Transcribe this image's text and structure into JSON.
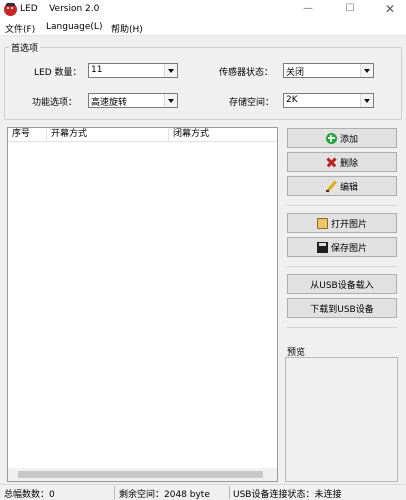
{
  "window": {
    "title": "LED    Version 2.0",
    "min_glyph": "—",
    "max_glyph": "☐",
    "close_glyph": "✕"
  },
  "menu": {
    "items": [
      "文件(F)",
      "Language(L)",
      "帮助(H)"
    ]
  },
  "options": {
    "legend": "首选项",
    "led_count_label": "LED 数量：",
    "led_count_value": "11",
    "sensor_label": "传感器状态：",
    "sensor_value": "关闭",
    "function_label": "功能选项：",
    "function_value": "高速旋转",
    "storage_label": "存储空间：",
    "storage_value": "2K"
  },
  "list": {
    "columns": [
      "序号",
      "开幕方式",
      "闭幕方式"
    ]
  },
  "buttons": {
    "add": "添加",
    "delete": "删除",
    "edit": "编辑",
    "open_image": "打开图片",
    "save_image": "保存图片",
    "load_usb": "从USB设备载入",
    "download_usb": "下载到USB设备"
  },
  "preview": {
    "label": "预览"
  },
  "status": {
    "total_slides": "总幅数数：0",
    "free_space": "剩余空间：2048 byte",
    "usb_status": "USB设备连接状态：未连接"
  },
  "colors": {
    "accent_add": "#21a639",
    "accent_delete": "#c0201e",
    "app_icon": "#c62828"
  }
}
